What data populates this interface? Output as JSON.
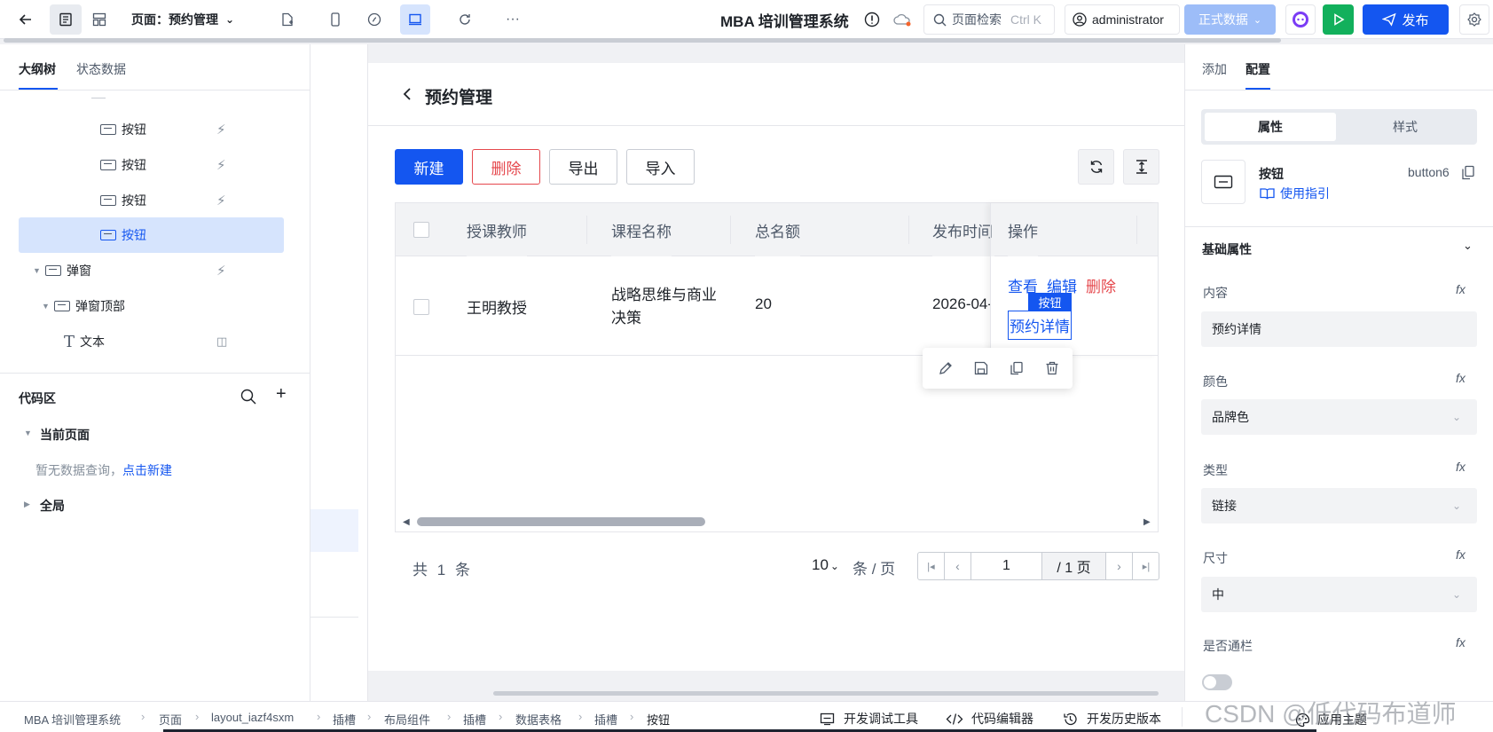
{
  "topbar": {
    "page_label": "页面：预约管理",
    "app_title": "MBA 培训管理系统",
    "search_placeholder": "页面检索",
    "search_shortcut": "Ctrl K",
    "user": "administrator",
    "env": "正式数据",
    "publish": "发布"
  },
  "left": {
    "tabs": [
      "大纲树",
      "状态数据"
    ],
    "tree": [
      {
        "label": "按钮"
      },
      {
        "label": "按钮"
      },
      {
        "label": "按钮"
      },
      {
        "label": "按钮"
      },
      {
        "label": "弹窗"
      },
      {
        "label": "弹窗顶部"
      },
      {
        "label": "文本"
      }
    ],
    "code_title": "代码区",
    "current_page": "当前页面",
    "empty_text": "暂无数据查询，",
    "create_link": "点击新建",
    "global": "全局"
  },
  "page": {
    "title": "预约管理",
    "buttons": {
      "new": "新建",
      "delete": "删除",
      "export": "导出",
      "import": "导入"
    },
    "columns": [
      "授课教师",
      "课程名称",
      "总名额",
      "发布时间",
      "操作"
    ],
    "row": {
      "teacher": "王明教授",
      "course_line1": "战略思维与商业",
      "course_line2": "决策",
      "quota": "20",
      "date": "2026-04-",
      "actions": {
        "view": "查看",
        "edit": "编辑",
        "delete": "删除",
        "detail": "预约详情"
      }
    },
    "sel_tag": "按钮",
    "pagination": {
      "total_prefix": "共",
      "total": "1",
      "total_suffix": "条",
      "page_size": "10",
      "per_page": "条 / 页",
      "current": "1",
      "pages": "/ 1 页"
    }
  },
  "right": {
    "tabs": [
      "添加",
      "配置"
    ],
    "segment": [
      "属性",
      "样式"
    ],
    "component_name": "按钮",
    "component_id": "button6",
    "guide": "使用指引",
    "section": "基础属性",
    "fields": [
      {
        "label": "内容",
        "value": "预约详情"
      },
      {
        "label": "颜色",
        "value": "品牌色"
      },
      {
        "label": "类型",
        "value": "链接"
      },
      {
        "label": "尺寸",
        "value": "中"
      }
    ],
    "fullwidth_label": "是否通栏",
    "fx": "fx"
  },
  "bottom": {
    "crumbs": [
      "MBA 培训管理系统",
      "页面",
      "layout_iazf4sxm",
      "插槽",
      "布局组件",
      "插槽",
      "数据表格",
      "插槽",
      "按钮"
    ],
    "tools": [
      "开发调试工具",
      "代码编辑器",
      "开发历史版本",
      "应用主题"
    ],
    "watermark": "CSDN @低代码布道师"
  },
  "colors": {
    "brand": "#1456f0",
    "danger": "#e5484d",
    "green": "#12b05c",
    "env": "#9dbdf8"
  }
}
